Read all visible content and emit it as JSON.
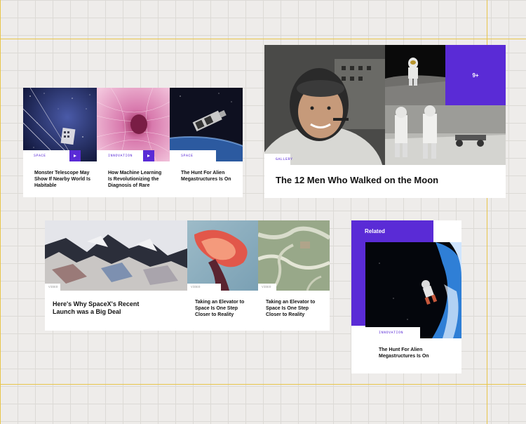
{
  "cards_row1": [
    {
      "tag": "SPACE",
      "title": "Monster Telescope May Show If Nearby World Is Habitable"
    },
    {
      "tag": "INNOVATION",
      "title": "How Machine Learning Is Revolutionizing the Diagnosis of Rare"
    },
    {
      "tag": "SPACE",
      "title": "The Hunt For Alien Megastructures Is On"
    }
  ],
  "gallery": {
    "tag": "GALLERY",
    "title": "The 12 Men Who Walked on the Moon",
    "count": "9+"
  },
  "video_row": [
    {
      "tag": "VIDEO",
      "title": "Here's Why SpaceX's Recent Launch was a Big Deal"
    },
    {
      "tag": "VIDEO",
      "title": "Taking an Elevator to Space Is One Step Closer to Reality"
    },
    {
      "tag": "VIDEO",
      "title": "Taking an Elevator to Space Is One Step Closer to Reality"
    }
  ],
  "related": {
    "label": "Related",
    "tag": "INNOVATION",
    "title": "The Hunt For Alien Megastructures Is On"
  },
  "colors": {
    "accent": "#5a2bd6",
    "guide": "#e8c54a",
    "background": "#eeecea"
  }
}
